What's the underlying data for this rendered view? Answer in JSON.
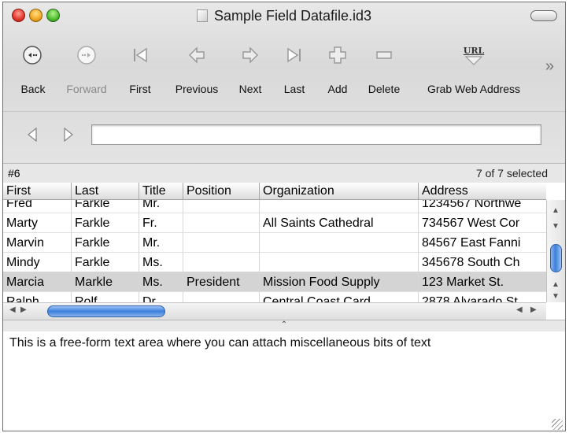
{
  "window": {
    "title": "Sample Field Datafile.id3"
  },
  "toolbar": {
    "back": "Back",
    "forward": "Forward",
    "first": "First",
    "previous": "Previous",
    "next": "Next",
    "last": "Last",
    "add": "Add",
    "delete": "Delete",
    "grab_web": "Grab Web Address",
    "url_badge": "URL",
    "overflow": "»"
  },
  "nav": {
    "field_value": ""
  },
  "status": {
    "record": "#6",
    "selected": "7 of 7 selected"
  },
  "table": {
    "columns": [
      "First",
      "Last",
      "Title",
      "Position",
      "Organization",
      "Address"
    ],
    "rows": [
      [
        "Fred",
        "Farkle",
        "Mr.",
        "",
        "",
        "1234567 Northwe"
      ],
      [
        "Marty",
        "Farkle",
        "Fr.",
        "",
        "All Saints Cathedral",
        "734567 West Cor"
      ],
      [
        "Marvin",
        "Farkle",
        "Mr.",
        "",
        "",
        "84567 East Fanni"
      ],
      [
        "Mindy",
        "Farkle",
        "Ms.",
        "",
        "",
        "345678 South Ch"
      ],
      [
        "Marcia",
        "Markle",
        "Ms.",
        "President",
        "Mission Food Supply",
        "123 Market St."
      ],
      [
        "Ralph",
        "Rolf",
        "Dr.",
        "",
        "Central Coast Card…",
        "2878 Alvarado St"
      ]
    ],
    "selected_row": 4
  },
  "notes": {
    "text": "This is a free-form text area where you can attach miscellaneous bits of text"
  },
  "colors": {
    "selection": "#d4d4d4",
    "scroll_thumb": "#3c7fdc"
  }
}
